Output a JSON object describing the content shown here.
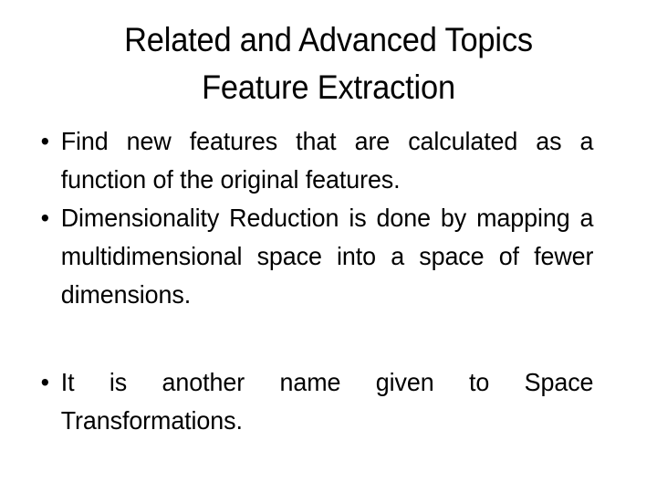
{
  "slide": {
    "background_color": "#ffffff",
    "text_color": "#000000",
    "title": {
      "line1": "Related and Advanced Topics",
      "line2": "Feature Extraction"
    },
    "bullets": [
      {
        "marker": "•",
        "text": "Find new features that are calculated as a function of the original features."
      },
      {
        "marker": "•",
        "text": "Dimensionality Reduction is done by mapping a multidimensional space into a space of fewer dimensions."
      },
      {
        "marker": "•",
        "text": "It is another name given to Space Transformations."
      }
    ]
  }
}
